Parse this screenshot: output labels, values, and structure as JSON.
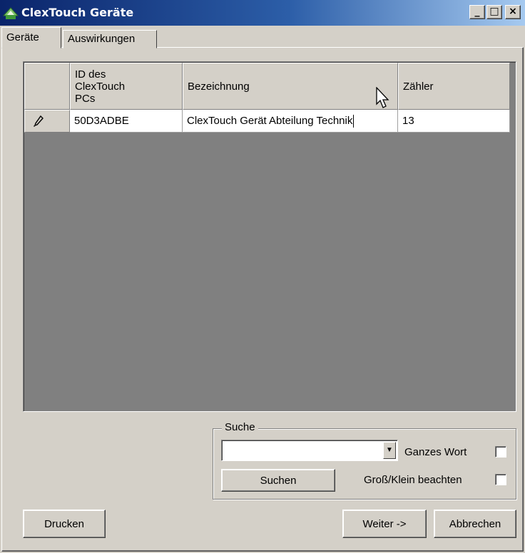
{
  "window": {
    "title": "ClexTouch Geräte",
    "controls": {
      "minimize": "_",
      "maximize": "□",
      "close": "×"
    }
  },
  "tabs": [
    {
      "label": "Geräte",
      "active": true
    },
    {
      "label": "Auswirkungen",
      "active": false
    }
  ],
  "grid": {
    "columns": [
      "",
      "ID des ClexTouch PCs",
      "Bezeichnung",
      "Zähler"
    ],
    "rows": [
      {
        "row_icon": "pencil-icon",
        "id": "50D3ADBE",
        "bezeichnung": "ClexTouch Gerät Abteilung Technik",
        "zaehler": "13"
      }
    ]
  },
  "search": {
    "group_label": "Suche",
    "input_value": "",
    "search_button": "Suchen",
    "whole_word_label": "Ganzes Wort",
    "whole_word_checked": false,
    "case_label": "Groß/Klein beachten",
    "case_checked": false
  },
  "buttons": {
    "print": "Drucken",
    "next": "Weiter ->",
    "cancel": "Abbrechen"
  },
  "colors": {
    "titlebar_start": "#0a246a",
    "titlebar_end": "#a6caf0",
    "window_bg": "#d4d0c8",
    "grid_bg": "#808080"
  }
}
